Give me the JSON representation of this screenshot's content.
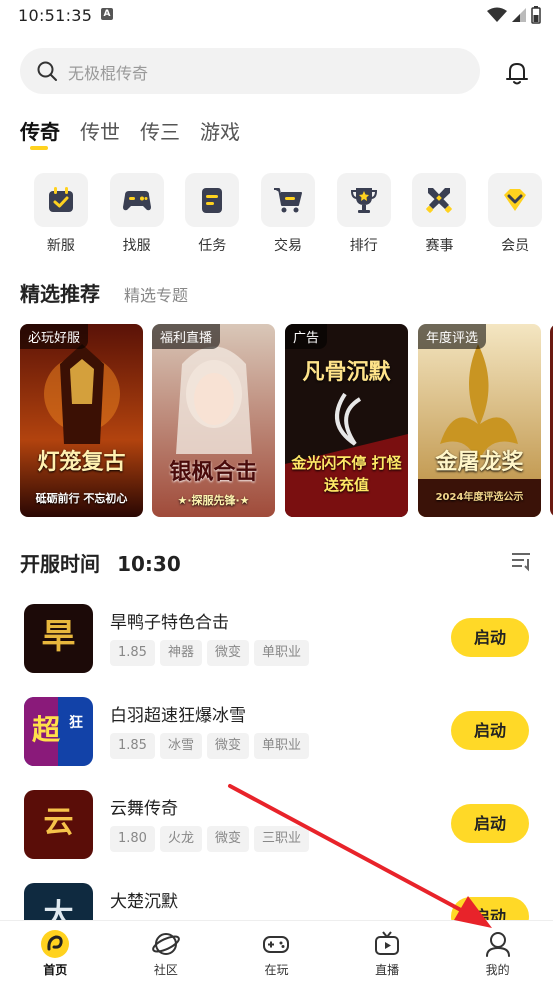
{
  "status": {
    "time": "10:51:35",
    "badge": "A"
  },
  "search": {
    "placeholder": "无极棍传奇"
  },
  "tabs": [
    {
      "label": "传奇",
      "active": true
    },
    {
      "label": "传世",
      "active": false
    },
    {
      "label": "传三",
      "active": false
    },
    {
      "label": "游戏",
      "active": false
    }
  ],
  "quick": [
    {
      "label": "新服",
      "icon": "calendar-check-icon"
    },
    {
      "label": "找服",
      "icon": "gamepad-icon"
    },
    {
      "label": "任务",
      "icon": "task-list-icon"
    },
    {
      "label": "交易",
      "icon": "cart-icon"
    },
    {
      "label": "排行",
      "icon": "trophy-icon"
    },
    {
      "label": "赛事",
      "icon": "crossed-swords-icon"
    },
    {
      "label": "会员",
      "icon": "vip-diamond-icon"
    }
  ],
  "featured": {
    "title": "精选推荐",
    "subtitle": "精选专题",
    "banners": [
      {
        "tag": "必玩好服",
        "caption": "灯笼复古",
        "sub": "砥砺前行 不忘初心"
      },
      {
        "tag": "福利直播",
        "caption": "银枫合击",
        "sub": "★·探服先锋·★"
      },
      {
        "tag": "广告",
        "caption": "凡骨沉默",
        "sub": "金光闪不停 打怪送充值"
      },
      {
        "tag": "年度评选",
        "caption": "金屠龙奖",
        "sub": "2024年度评选公示"
      }
    ]
  },
  "servers": {
    "title": "开服时间",
    "time": "10:30",
    "items": [
      {
        "name": "旱鸭子特色合击",
        "tags": [
          "1.85",
          "神器",
          "微变",
          "单职业"
        ],
        "button": "启动"
      },
      {
        "name": "白羽超速狂爆冰雪",
        "tags": [
          "1.85",
          "冰雪",
          "微变",
          "单职业"
        ],
        "button": "启动"
      },
      {
        "name": "云舞传奇",
        "tags": [
          "1.80",
          "火龙",
          "微变",
          "三职业"
        ],
        "button": "启动"
      },
      {
        "name": "大楚沉默",
        "tags": [
          "",
          "",
          "",
          ""
        ],
        "button": "启动"
      }
    ]
  },
  "tabbar": [
    {
      "label": "首页",
      "icon": "home-logo-icon",
      "active": true
    },
    {
      "label": "社区",
      "icon": "planet-icon",
      "active": false
    },
    {
      "label": "在玩",
      "icon": "controller-icon",
      "active": false
    },
    {
      "label": "直播",
      "icon": "tv-play-icon",
      "active": false
    },
    {
      "label": "我的",
      "icon": "user-icon",
      "active": false
    }
  ],
  "colors": {
    "accent": "#ffd927",
    "arrow": "#e8232a"
  }
}
